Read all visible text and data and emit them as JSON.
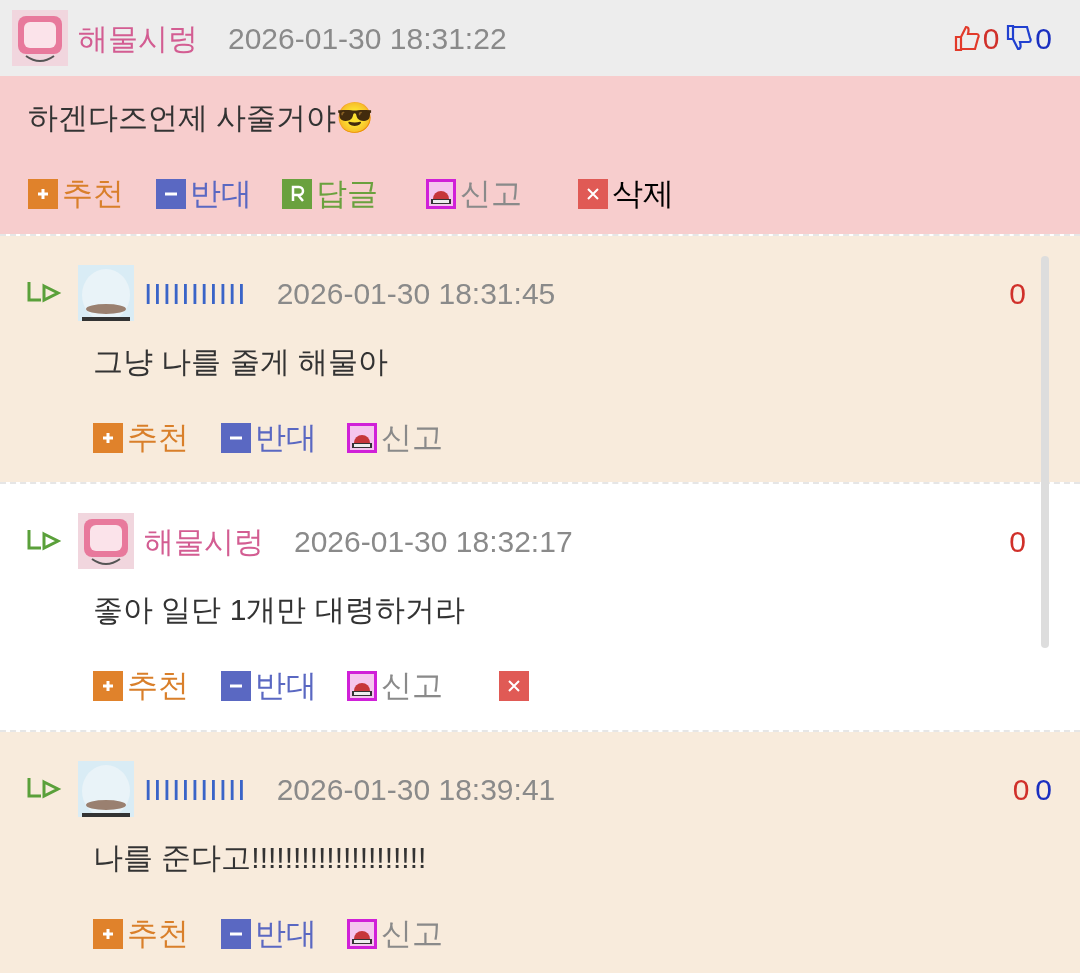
{
  "comments": [
    {
      "kind": "comment",
      "author": "해물시렁",
      "avatar": {
        "kind": "pink"
      },
      "time": "2026-01-30 18:31:22",
      "likes": "0",
      "dislikes": "0",
      "text": "하겐다즈언제 사줄거야😎",
      "actions": [
        {
          "kind": "recommend",
          "label": "추천"
        },
        {
          "kind": "oppose",
          "label": "반대"
        },
        {
          "kind": "reply",
          "label": "답글"
        },
        {
          "kind": "report",
          "label": "신고"
        },
        {
          "kind": "delete",
          "label": "삭제"
        }
      ]
    },
    {
      "kind": "reply",
      "author": "IIIIIIIIIII",
      "avatar": {
        "kind": "face"
      },
      "time": "2026-01-30 18:31:45",
      "likes": "0",
      "text": "그냥 나를 줄게 해물아",
      "actions": [
        {
          "kind": "recommend",
          "label": "추천"
        },
        {
          "kind": "oppose",
          "label": "반대"
        },
        {
          "kind": "report",
          "label": "신고"
        }
      ]
    },
    {
      "kind": "reply",
      "author": "해물시렁",
      "avatar": {
        "kind": "pink"
      },
      "time": "2026-01-30 18:32:17",
      "likes": "0",
      "text": "좋아 일단 1개만 대령하거라",
      "actions": [
        {
          "kind": "recommend",
          "label": "추천"
        },
        {
          "kind": "oppose",
          "label": "반대"
        },
        {
          "kind": "report",
          "label": "신고"
        },
        {
          "kind": "delete"
        }
      ]
    },
    {
      "kind": "reply",
      "author": "IIIIIIIIIII",
      "avatar": {
        "kind": "face"
      },
      "time": "2026-01-30 18:39:41",
      "likes": "0",
      "dislikes": "0",
      "text": "나를 준다고!!!!!!!!!!!!!!!!!!!!!",
      "actions": [
        {
          "kind": "recommend",
          "label": "추천"
        },
        {
          "kind": "oppose",
          "label": "반대"
        },
        {
          "kind": "report",
          "label": "신고"
        }
      ]
    }
  ]
}
